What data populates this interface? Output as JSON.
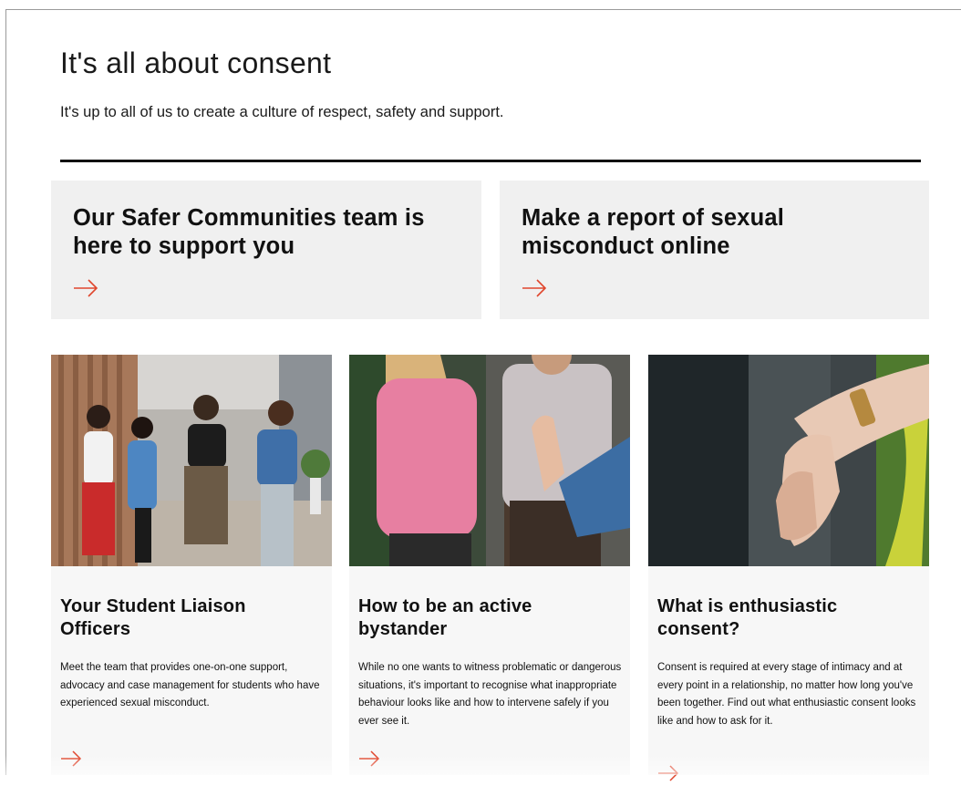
{
  "section": {
    "title": "It's all about consent",
    "subtitle": "It's up to all of us to create a culture of respect, safety and support."
  },
  "promos": [
    {
      "title": "Our Safer Communities team is here to support you",
      "icon": "arrow-right-icon"
    },
    {
      "title": "Make a report of sexual misconduct online",
      "icon": "arrow-right-icon"
    }
  ],
  "cards": [
    {
      "title": "Your Student Liaison Officers",
      "description": "Meet the team that provides one-on-one support, advocacy and case management for students who have experienced sexual misconduct.",
      "image": "group-of-staff-photo",
      "icon": "arrow-right-icon"
    },
    {
      "title": "How to be an active bystander",
      "description": "While no one wants to witness problematic or dangerous situations, it's important to recognise what inappropriate behaviour looks like and how to intervene safely if you ever see it.",
      "image": "raised-hand-photo",
      "icon": "arrow-right-icon"
    },
    {
      "title": "What is enthusiastic consent?",
      "description": "Consent is required at every stage of intimacy and at every point in a relationship, no matter how long you've been together. Find out what enthusiastic consent looks like and how to ask for it.",
      "image": "holding-hands-photo",
      "icon": "arrow-right-icon"
    }
  ],
  "colors": {
    "accent_arrow": "#e0462d",
    "promo_background": "#f0f0f0",
    "card_background": "#f7f7f7",
    "rule": "#111111"
  }
}
